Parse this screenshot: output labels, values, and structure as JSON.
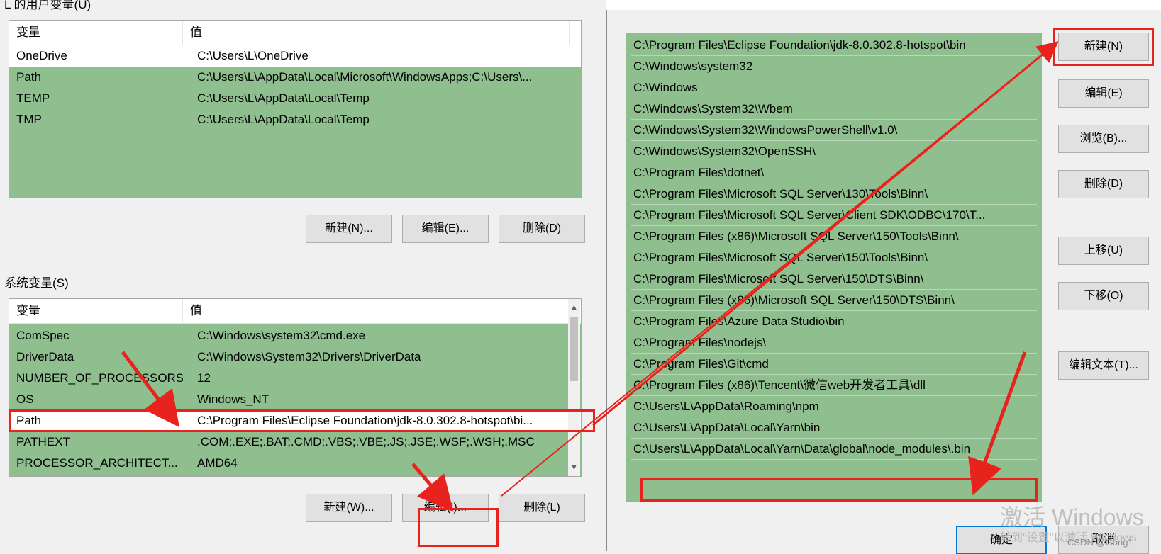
{
  "user_vars": {
    "group_title": "L 的用户变量(U)",
    "col_name": "变量",
    "col_value": "值",
    "rows": [
      {
        "name": "OneDrive",
        "value": "C:\\Users\\L\\OneDrive"
      },
      {
        "name": "Path",
        "value": "C:\\Users\\L\\AppData\\Local\\Microsoft\\WindowsApps;C:\\Users\\..."
      },
      {
        "name": "TEMP",
        "value": "C:\\Users\\L\\AppData\\Local\\Temp"
      },
      {
        "name": "TMP",
        "value": "C:\\Users\\L\\AppData\\Local\\Temp"
      }
    ],
    "buttons": {
      "new": "新建(N)...",
      "edit": "编辑(E)...",
      "delete": "删除(D)"
    }
  },
  "sys_vars": {
    "group_title": "系统变量(S)",
    "col_name": "变量",
    "col_value": "值",
    "rows": [
      {
        "name": "ComSpec",
        "value": "C:\\Windows\\system32\\cmd.exe"
      },
      {
        "name": "DriverData",
        "value": "C:\\Windows\\System32\\Drivers\\DriverData"
      },
      {
        "name": "NUMBER_OF_PROCESSORS",
        "value": "12"
      },
      {
        "name": "OS",
        "value": "Windows_NT"
      },
      {
        "name": "Path",
        "value": "C:\\Program Files\\Eclipse Foundation\\jdk-8.0.302.8-hotspot\\bi..."
      },
      {
        "name": "PATHEXT",
        "value": ".COM;.EXE;.BAT;.CMD;.VBS;.VBE;.JS;.JSE;.WSF;.WSH;.MSC"
      },
      {
        "name": "PROCESSOR_ARCHITECT...",
        "value": "AMD64"
      }
    ],
    "buttons": {
      "new": "新建(W)...",
      "edit": "编辑(I)...",
      "delete": "删除(L)"
    }
  },
  "edit_path": {
    "entries": [
      "C:\\Program Files\\Eclipse Foundation\\jdk-8.0.302.8-hotspot\\bin",
      "C:\\Windows\\system32",
      "C:\\Windows",
      "C:\\Windows\\System32\\Wbem",
      "C:\\Windows\\System32\\WindowsPowerShell\\v1.0\\",
      "C:\\Windows\\System32\\OpenSSH\\",
      "C:\\Program Files\\dotnet\\",
      "C:\\Program Files\\Microsoft SQL Server\\130\\Tools\\Binn\\",
      "C:\\Program Files\\Microsoft SQL Server\\Client SDK\\ODBC\\170\\T...",
      "C:\\Program Files (x86)\\Microsoft SQL Server\\150\\Tools\\Binn\\",
      "C:\\Program Files\\Microsoft SQL Server\\150\\Tools\\Binn\\",
      "C:\\Program Files\\Microsoft SQL Server\\150\\DTS\\Binn\\",
      "C:\\Program Files (x86)\\Microsoft SQL Server\\150\\DTS\\Binn\\",
      "C:\\Program Files\\Azure Data Studio\\bin",
      "C:\\Program Files\\nodejs\\",
      "C:\\Program Files\\Git\\cmd",
      "C:\\Program Files (x86)\\Tencent\\微信web开发者工具\\dll",
      "C:\\Users\\L\\AppData\\Roaming\\npm",
      "C:\\Users\\L\\AppData\\Local\\Yarn\\bin",
      "C:\\Users\\L\\AppData\\Local\\Yarn\\Data\\global\\node_modules\\.bin",
      ""
    ],
    "buttons": {
      "new": "新建(N)",
      "edit": "编辑(E)",
      "browse": "浏览(B)...",
      "delete": "删除(D)",
      "move_up": "上移(U)",
      "move_down": "下移(O)",
      "edit_text": "编辑文本(T)...",
      "ok": "确定",
      "cancel": "取消"
    }
  },
  "watermark": {
    "activate": "激活 Windows",
    "goto": "转到\"设置\"以激活 Windows",
    "csdn": "CSDN @Gong1"
  },
  "colors": {
    "selected_row": "#8fbf8f",
    "annotation": "#e8231d"
  }
}
